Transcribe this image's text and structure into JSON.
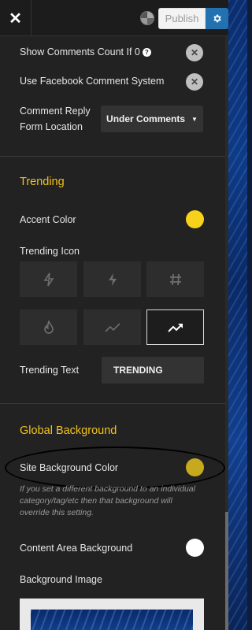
{
  "topbar": {
    "close_icon": "close-icon",
    "publish_label": "Publish",
    "settings_icon": "gear-icon"
  },
  "comments": {
    "show_count_label": "Show Comments Count If 0",
    "facebook_label": "Use Facebook Comment System",
    "reply_form_label_1": "Comment Reply",
    "reply_form_label_2": "Form Location",
    "reply_form_value": "Under Comments"
  },
  "trending": {
    "title": "Trending",
    "accent_label": "Accent Color",
    "accent_color": "#f7d21b",
    "icon_label": "Trending Icon",
    "icons": [
      "bolt-outline-icon",
      "bolt-filled-icon",
      "hash-icon",
      "flame-icon",
      "trend-line-icon",
      "trend-arrow-icon"
    ],
    "selected_icon": "trend-arrow-icon",
    "text_label": "Trending Text",
    "text_value": "TRENDING"
  },
  "global_background": {
    "title": "Global Background",
    "site_bg_label": "Site Background Color",
    "site_bg_color": "#c6a91c",
    "description": "If you set a different background to an individual category/tag/etc then that background will override this setting.",
    "content_bg_label": "Content Area Background",
    "content_bg_color": "#ffffff",
    "bg_image_label": "Background Image"
  },
  "colors": {
    "accent_title": "#f2c21b",
    "panel": "#222222",
    "publish_button": "#2271b1"
  }
}
